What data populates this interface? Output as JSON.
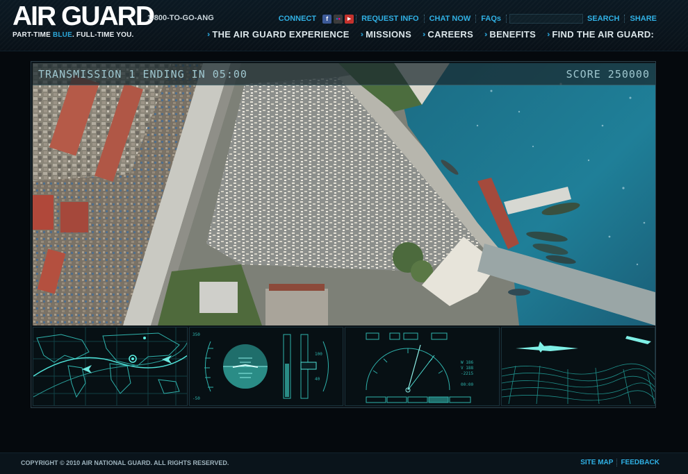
{
  "header": {
    "logo": "AIR GUARD",
    "tagline_pre": "PART-TIME ",
    "tagline_blue": "BLUE",
    "tagline_post": ". FULL-TIME YOU.",
    "phone": "1-800-TO-GO-ANG"
  },
  "utility": {
    "connect": "CONNECT",
    "social": [
      {
        "icon": "facebook-icon",
        "glyph": "f"
      },
      {
        "icon": "flickr-icon",
        "glyph": "••"
      },
      {
        "icon": "youtube-icon",
        "glyph": "▶"
      }
    ],
    "request_info": "REQUEST INFO",
    "chat_now": "CHAT NOW",
    "faqs": "FAQs",
    "search_label": "SEARCH",
    "share": "SHARE"
  },
  "nav": [
    {
      "label": "THE AIR GUARD EXPERIENCE"
    },
    {
      "label": "MISSIONS"
    },
    {
      "label": "CAREERS"
    },
    {
      "label": "BENEFITS"
    },
    {
      "label": "FIND THE AIR GUARD:"
    }
  ],
  "game": {
    "transmission": "TRANSMISSION 1 ENDING IN 05:00",
    "score": "SCORE 250000",
    "panels": [
      {
        "name": "world-map-panel"
      },
      {
        "name": "attitude-indicator-panel"
      },
      {
        "name": "navigation-instrument-panel"
      },
      {
        "name": "terrain-uav-panel"
      }
    ]
  },
  "footer": {
    "copyright": "COPYRIGHT © 2010 AIR NATIONAL GUARD. ALL RIGHTS RESERVED.",
    "site_map": "SITE MAP",
    "feedback": "FEEDBACK"
  },
  "colors": {
    "accent": "#2fb0e4",
    "hud": "#9fc7cf",
    "instrument": "#3fc9c4",
    "water": "#1f7d96"
  }
}
